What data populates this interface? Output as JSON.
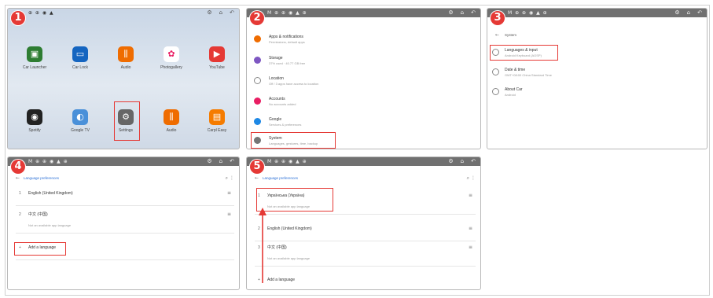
{
  "steps": [
    "1",
    "2",
    "3",
    "4",
    "5"
  ],
  "statusbar": {
    "icons": "M ⊕ ⊕ ◉ ▲ ⊕",
    "home_icons": "⊕ ⊕ ◉ ▲",
    "btn_settings": "⚙",
    "btn_home": "⌂",
    "btn_back": "↶"
  },
  "panel1": {
    "apps_row1": [
      {
        "label": "Car Launcher",
        "color": "#2e7d32",
        "icon": "car-icon",
        "glyph": "▣"
      },
      {
        "label": "Car Lock",
        "color": "#1565c0",
        "icon": "car-lock-icon",
        "glyph": "▭"
      },
      {
        "label": "Audio",
        "color": "#ef6c00",
        "icon": "equalizer-icon",
        "glyph": "⫼"
      },
      {
        "label": "Photogallery",
        "color": "#ffffff",
        "icon": "photos-icon",
        "glyph": "✿"
      },
      {
        "label": "YouTube",
        "color": "#e53935",
        "icon": "youtube-icon",
        "glyph": "▶"
      }
    ],
    "apps_row2": [
      {
        "label": "Spotify",
        "color": "#222222",
        "icon": "spotify-icon",
        "glyph": "◉"
      },
      {
        "label": "Google TV",
        "color": "#4a90d9",
        "icon": "browser-icon",
        "glyph": "◐"
      },
      {
        "label": "Settings",
        "color": "#666666",
        "icon": "settings-gear-icon",
        "glyph": "⚙"
      },
      {
        "label": "Audio",
        "color": "#ef6c00",
        "icon": "equalizer-icon",
        "glyph": "⫼"
      },
      {
        "label": "Carpl Easy",
        "color": "#f57c00",
        "icon": "carplay-icon",
        "glyph": "▤"
      }
    ]
  },
  "panel2": {
    "items": [
      {
        "title": "Apps & notifications",
        "sub": "Permissions, default apps",
        "color": "#ef6c00"
      },
      {
        "title": "Storage",
        "sub": "37% used · 40.77 GB free",
        "color": "#7e57c2"
      },
      {
        "title": "Location",
        "sub": "Off / 3 apps have access to location",
        "color": "#ffffff"
      },
      {
        "title": "Accounts",
        "sub": "No accounts added",
        "color": "#e91e63"
      },
      {
        "title": "Google",
        "sub": "Services & preferences",
        "color": "#1e88e5"
      },
      {
        "title": "System",
        "sub": "Languages, gestures, time, backup",
        "color": "#757575"
      }
    ]
  },
  "panel3": {
    "breadcrumb": "System",
    "items": [
      {
        "title": "Languages & input",
        "sub": "Android Keyboard (AOSP)"
      },
      {
        "title": "Date & time",
        "sub": "GMT+08:00 China Standard Time"
      },
      {
        "title": "About Car",
        "sub": "Android"
      }
    ]
  },
  "panel4": {
    "header": "Language preferences",
    "items": [
      {
        "num": "1",
        "title": "English (United Kingdom)",
        "sub": ""
      },
      {
        "num": "2",
        "title": "中文 (中国)",
        "sub": "Not an available app language"
      },
      {
        "num": "+",
        "title": "Add a language",
        "sub": ""
      }
    ],
    "search_icon": "⌕",
    "more_icon": "⋮"
  },
  "panel5": {
    "header": "Language preferences",
    "items": [
      {
        "num": "1",
        "title": "Українська (Україна)",
        "sub": "Not an available app language"
      },
      {
        "num": "2",
        "title": "English (United Kingdom)",
        "sub": ""
      },
      {
        "num": "3",
        "title": "中文 (中国)",
        "sub": "Not an available app language"
      },
      {
        "num": "+",
        "title": "Add a language",
        "sub": ""
      }
    ],
    "search_icon": "⌕",
    "more_icon": "⋮",
    "drag_icon": "≡"
  },
  "colors": {
    "highlight": "#e53935",
    "step_badge": "#e53935"
  }
}
